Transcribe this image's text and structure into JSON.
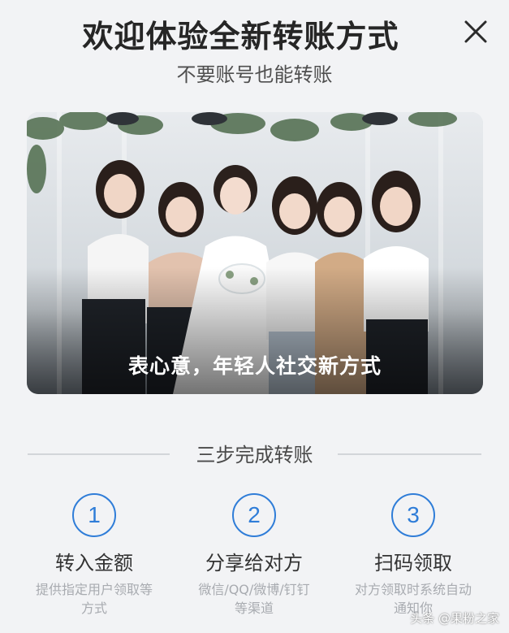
{
  "header": {
    "title": "欢迎体验全新转账方式",
    "subtitle": "不要账号也能转账"
  },
  "hero": {
    "caption": "表心意，年轻人社交新方式"
  },
  "section": {
    "title": "三步完成转账"
  },
  "steps": [
    {
      "number": "1",
      "title": "转入金额",
      "desc_line1": "提供指定用户领取等",
      "desc_line2": "方式"
    },
    {
      "number": "2",
      "title": "分享给对方",
      "desc_line1": "微信/QQ/微博/钉钉",
      "desc_line2": "等渠道"
    },
    {
      "number": "3",
      "title": "扫码领取",
      "desc_line1": "对方领取时系统自动",
      "desc_line2": "通知你"
    }
  ],
  "watermark": "头条 @果粉之家",
  "colors": {
    "accent": "#2f7dd8",
    "background": "#f2f3f5"
  },
  "icons": {
    "close": "close-icon"
  }
}
